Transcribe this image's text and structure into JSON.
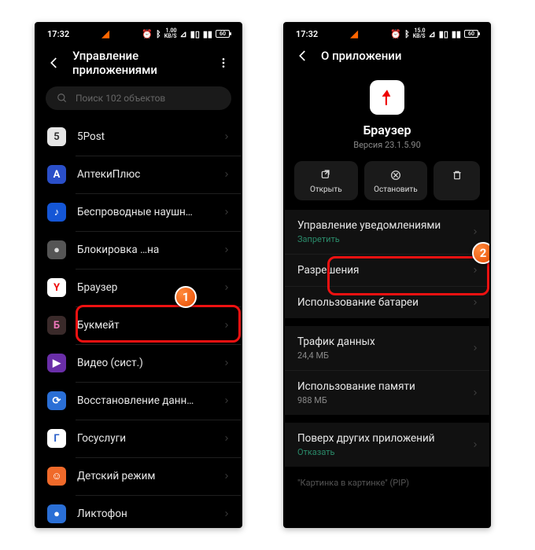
{
  "status": {
    "time": "17:32",
    "net_speed_top": "1.00",
    "net_speed_unit": "KB/S",
    "net_speed_top2": "15.0",
    "battery": "60"
  },
  "left": {
    "title": "Управление приложениями",
    "search_placeholder": "Поиск 102 объектов",
    "apps": [
      {
        "label": "5Post",
        "bg": "#e6e6e6",
        "fg": "#333",
        "glyph": "5"
      },
      {
        "label": "АптекиПлюс",
        "bg": "#2a4fc9",
        "fg": "#fff",
        "glyph": "A"
      },
      {
        "label": "Беспроводные наушн…",
        "bg": "#1456d6",
        "fg": "#fff",
        "glyph": "♪"
      },
      {
        "label": "Блокировка    …на",
        "bg": "#555",
        "fg": "#ddd",
        "glyph": "●"
      },
      {
        "label": "Браузер",
        "bg": "#fff",
        "fg": "#e00",
        "glyph": "Y"
      },
      {
        "label": "Букмейт",
        "bg": "#3a2a2a",
        "fg": "#e7b",
        "glyph": "Б"
      },
      {
        "label": "Видео (сист.)",
        "bg": "#6a2ea8",
        "fg": "#fff",
        "glyph": "▶"
      },
      {
        "label": "Восстановление данн…",
        "bg": "#2a6fd6",
        "fg": "#fff",
        "glyph": "⟳"
      },
      {
        "label": "Госуслуги",
        "bg": "#fff",
        "fg": "#2a5fc9",
        "glyph": "Г"
      },
      {
        "label": "Детский режим",
        "bg": "#f06a2a",
        "fg": "#fff",
        "glyph": "☺"
      },
      {
        "label": "Ликтофон",
        "bg": "#2a6fd6",
        "fg": "#fff",
        "glyph": "●"
      }
    ]
  },
  "right": {
    "title": "О приложении",
    "app_name": "Браузер",
    "version": "Версия 23.1.5.90",
    "actions": {
      "open": "Открыть",
      "stop": "Остановить",
      "uninstall": ""
    },
    "rows": {
      "notifications": {
        "label": "Управление уведомлениями",
        "sub": "Запретить"
      },
      "permissions": {
        "label": "Разрешения"
      },
      "battery": {
        "label": "Использование батареи"
      },
      "traffic": {
        "label": "Трафик данных",
        "sub": "24,4 МБ"
      },
      "memory": {
        "label": "Использование памяти",
        "sub": "988 МБ"
      },
      "overlay": {
        "label": "Поверх других приложений",
        "sub": "Отказать"
      },
      "pip": {
        "label": "\"Картинка в картинке\" (PIP)"
      }
    }
  },
  "markers": {
    "one": "1",
    "two": "2"
  }
}
